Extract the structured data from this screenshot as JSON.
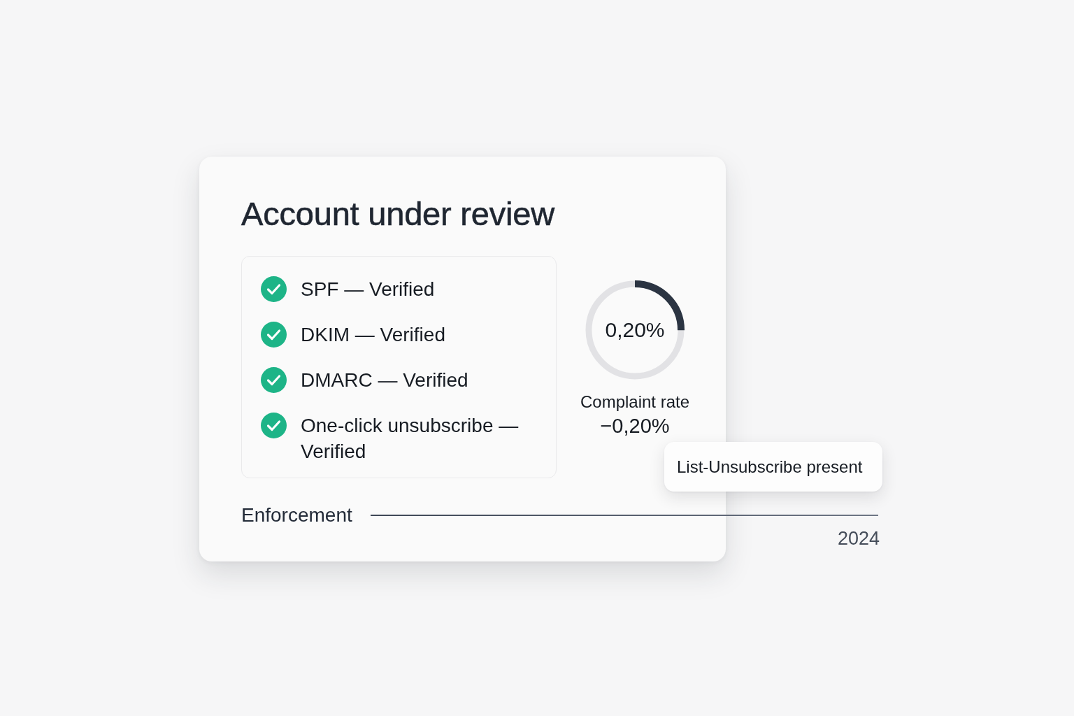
{
  "card": {
    "title": "Account under review",
    "checks": [
      {
        "label": "SPF — Verified",
        "checked": true
      },
      {
        "label": "DKIM — Verified",
        "checked": true
      },
      {
        "label": "DMARC — Verified",
        "checked": true
      },
      {
        "label": "One-click unsubscribe — Verified",
        "checked": true
      }
    ],
    "gauge": {
      "value": "0,20%",
      "level": 0.25,
      "label": "Complaint rate",
      "change": "−0,20%"
    },
    "tooltip": {
      "text": "List-Unsubscribe present"
    },
    "timeline": {
      "label": "Enforcement",
      "year": "2024"
    }
  }
}
